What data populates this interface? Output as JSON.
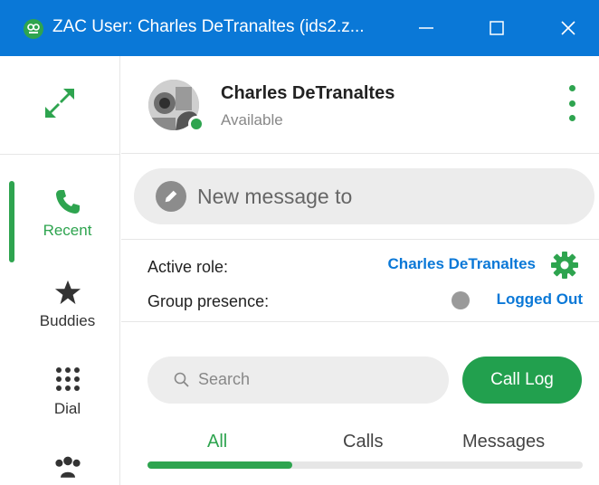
{
  "window": {
    "title": "ZAC User: Charles DeTranaltes (ids2.z...",
    "titlebar_color": "#0a78d7"
  },
  "rail": {
    "expand_icon": "expand-arrows-icon",
    "items": [
      {
        "label": "Recent",
        "icon": "phone-icon",
        "active": true
      },
      {
        "label": "Buddies",
        "icon": "star-icon",
        "active": false
      },
      {
        "label": "Dial",
        "icon": "dialpad-icon",
        "active": false
      },
      {
        "label": "",
        "icon": "group-icon",
        "active": false
      }
    ]
  },
  "profile": {
    "name": "Charles DeTranaltes",
    "status": "Available",
    "status_color": "#2ea44f"
  },
  "compose": {
    "placeholder": "New message to"
  },
  "roles": {
    "active_role_label": "Active role:",
    "active_role_value": "Charles DeTranaltes",
    "group_presence_label": "Group presence:",
    "group_presence_value": "Logged Out"
  },
  "search": {
    "placeholder": "Search"
  },
  "call_log_button": "Call Log",
  "tabs": [
    {
      "label": "All",
      "active": true
    },
    {
      "label": "Calls",
      "active": false
    },
    {
      "label": "Messages",
      "active": false
    }
  ],
  "colors": {
    "accent_green": "#2ea44f",
    "link_blue": "#0a78d7"
  }
}
